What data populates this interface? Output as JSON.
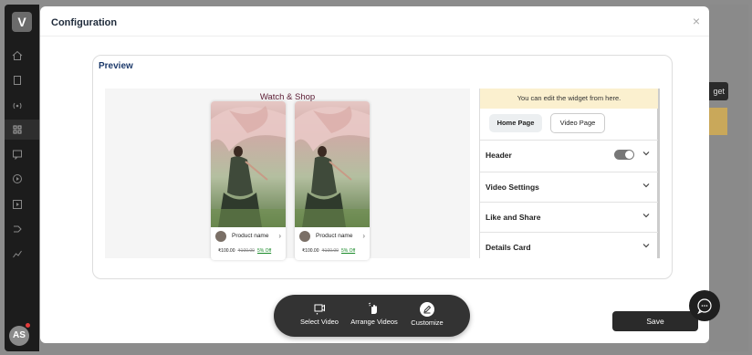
{
  "app": {
    "logo_letter": "V",
    "avatar_initials": "AS",
    "background_button_label": "get"
  },
  "modal": {
    "title": "Configuration",
    "close_label": "×"
  },
  "preview": {
    "title": "Preview",
    "widget_title": "Watch & Shop",
    "products": [
      {
        "name": "Product name",
        "price": "₹100.00",
        "old_price": "₹100.00",
        "discount": "5% Off"
      },
      {
        "name": "Product name",
        "price": "₹100.00",
        "old_price": "₹100.00",
        "discount": "5% Off"
      }
    ]
  },
  "settings": {
    "note": "You can edit the widget from here.",
    "home_page_label": "Home Page",
    "video_page_label": "Video Page",
    "sections": [
      {
        "label": "Header",
        "has_toggle": true,
        "toggle_on": true
      },
      {
        "label": "Video Settings"
      },
      {
        "label": "Like and Share"
      },
      {
        "label": "Details Card"
      }
    ]
  },
  "toolbar": {
    "select_video": "Select Video",
    "arrange_videos": "Arrange Videos",
    "customize": "Customize"
  },
  "save_label": "Save",
  "colors": {
    "note_bg": "#fbf0cf",
    "primary_dark": "#2a2a2a",
    "title_blue": "#1d3a6b",
    "widget_title": "#5a1a32",
    "discount_green": "#1a8a2a"
  }
}
